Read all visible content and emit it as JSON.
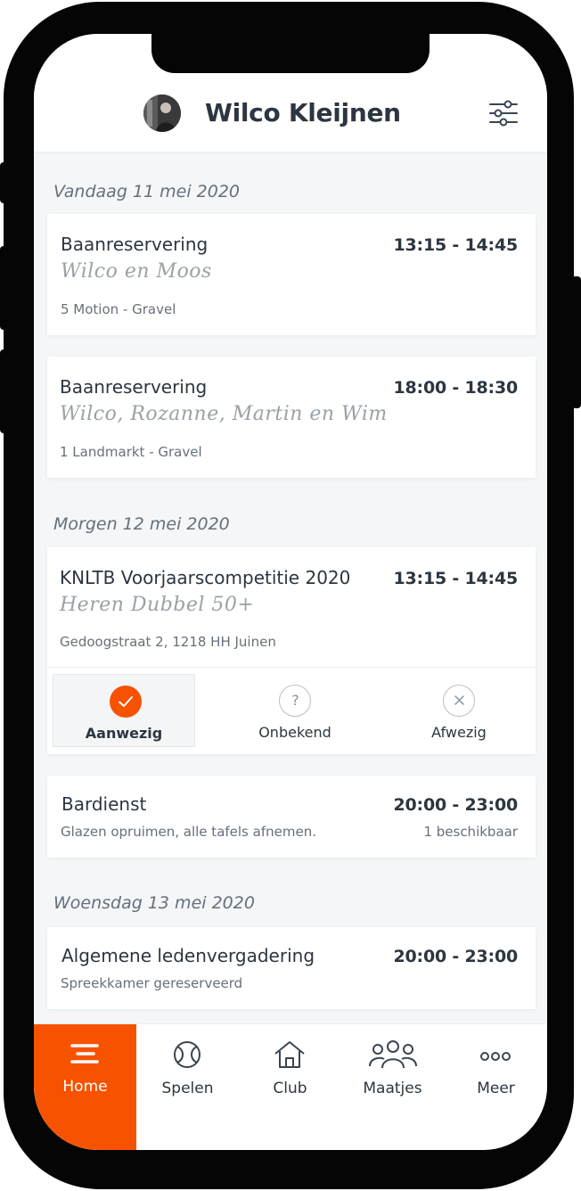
{
  "header": {
    "user_name": "Wilco Kleijnen",
    "avatar_icon": "user-avatar",
    "filter_icon": "sliders-icon"
  },
  "days": [
    {
      "label": "Vandaag 11 mei 2020",
      "items": [
        {
          "title": "Baanreservering",
          "time": "13:15 - 14:45",
          "players": "Wilco en Moos",
          "location": "5 Motion - Gravel"
        },
        {
          "title": "Baanreservering",
          "time": "18:00 - 18:30",
          "players": "Wilco, Rozanne, Martin en Wim",
          "location": "1 Landmarkt - Gravel"
        }
      ]
    },
    {
      "label": "Morgen 12 mei 2020",
      "items": [
        {
          "title": "KNLTB Voorjaarscompetitie 2020",
          "time": "13:15 - 14:45",
          "team": "Heren Dubbel 50+",
          "location": "Gedoogstraat 2, 1218 HH Juinen",
          "rsvp": [
            {
              "label": "Aanwezig",
              "icon": "check-icon",
              "selected": true
            },
            {
              "label": "Onbekend",
              "icon": "question-icon",
              "selected": false
            },
            {
              "label": "Afwezig",
              "icon": "close-icon",
              "selected": false
            }
          ]
        },
        {
          "title": "Bardienst",
          "time": "20:00 - 23:00",
          "description": "Glazen opruimen, alle tafels afnemen.",
          "availability": "1 beschikbaar"
        }
      ]
    },
    {
      "label": "Woensdag 13 mei 2020",
      "items": [
        {
          "title": "Algemene ledenvergadering",
          "time": "20:00 - 23:00",
          "description": "Spreekkamer gereserveerd"
        }
      ]
    }
  ],
  "tabbar": {
    "tabs": [
      {
        "label": "Home",
        "icon": "menu-icon",
        "active": true
      },
      {
        "label": "Spelen",
        "icon": "tennis-ball-icon",
        "active": false
      },
      {
        "label": "Club",
        "icon": "house-icon",
        "active": false
      },
      {
        "label": "Maatjes",
        "icon": "people-icon",
        "active": false
      },
      {
        "label": "Meer",
        "icon": "more-icon",
        "active": false
      }
    ]
  },
  "colors": {
    "accent": "#f75200",
    "text": "#2c3640",
    "muted": "#66707a",
    "subtitle": "#9aa1a8",
    "background": "#f4f6f8"
  }
}
